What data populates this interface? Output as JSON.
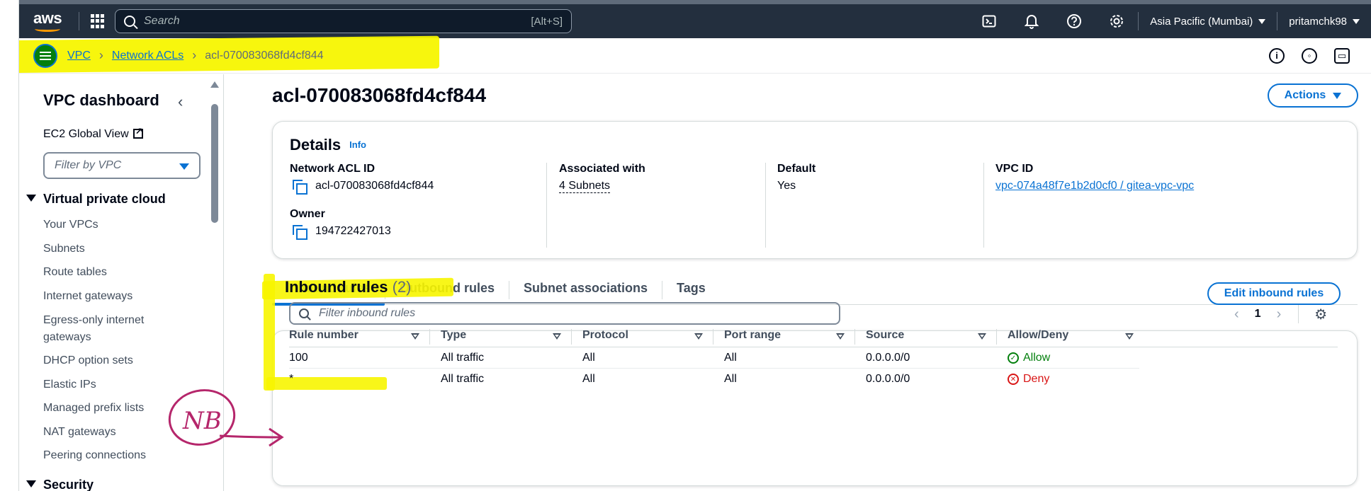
{
  "topbar": {
    "logo": "aws",
    "search_placeholder": "Search",
    "search_shortcut": "[Alt+S]",
    "region": "Asia Pacific (Mumbai)",
    "user": "pritamchk98",
    "icons": [
      "cloudshell-icon",
      "bell-icon",
      "help-icon",
      "gear-icon"
    ]
  },
  "breadcrumb": {
    "items": [
      "VPC",
      "Network ACLs"
    ],
    "current": "acl-070083068fd4cf844"
  },
  "sidebar": {
    "title": "VPC dashboard",
    "ec2_global_view": "EC2 Global View",
    "filter_placeholder": "Filter by VPC",
    "section_vpc": "Virtual private cloud",
    "items": [
      "Your VPCs",
      "Subnets",
      "Route tables",
      "Internet gateways",
      "Egress-only internet gateways",
      "DHCP option sets",
      "Elastic IPs",
      "Managed prefix lists",
      "NAT gateways",
      "Peering connections"
    ],
    "section_security": "Security"
  },
  "main": {
    "title": "acl-070083068fd4cf844",
    "actions_label": "Actions",
    "details": {
      "title": "Details",
      "info": "Info",
      "network_acl_id_label": "Network ACL ID",
      "network_acl_id": "acl-070083068fd4cf844",
      "owner_label": "Owner",
      "owner": "194722427013",
      "associated_label": "Associated with",
      "associated": "4 Subnets",
      "default_label": "Default",
      "default": "Yes",
      "vpc_id_label": "VPC ID",
      "vpc_id": "vpc-074a48f7e1b2d0cf0 / gitea-vpc-vpc"
    },
    "tabs": [
      "Inbound rules",
      "Outbound rules",
      "Subnet associations",
      "Tags"
    ],
    "inbound": {
      "title": "Inbound rules",
      "count": "(2)",
      "edit_label": "Edit inbound rules",
      "filter_placeholder": "Filter inbound rules",
      "page": "1",
      "columns": [
        "Rule number",
        "Type",
        "Protocol",
        "Port range",
        "Source",
        "Allow/Deny"
      ],
      "rows": [
        {
          "rule": "100",
          "type": "All traffic",
          "protocol": "All",
          "port": "All",
          "source": "0.0.0.0/0",
          "action": "Allow"
        },
        {
          "rule": "*",
          "type": "All traffic",
          "protocol": "All",
          "port": "All",
          "source": "0.0.0.0/0",
          "action": "Deny"
        }
      ]
    }
  },
  "annotation": {
    "text": "NB",
    "color": "#b5266b",
    "highlight_color": "#f7f500"
  },
  "colors": {
    "topbar": "#232f3e",
    "link": "#0972d3",
    "allow": "#037f0c",
    "deny": "#d91515",
    "accent": "#ff9900"
  }
}
